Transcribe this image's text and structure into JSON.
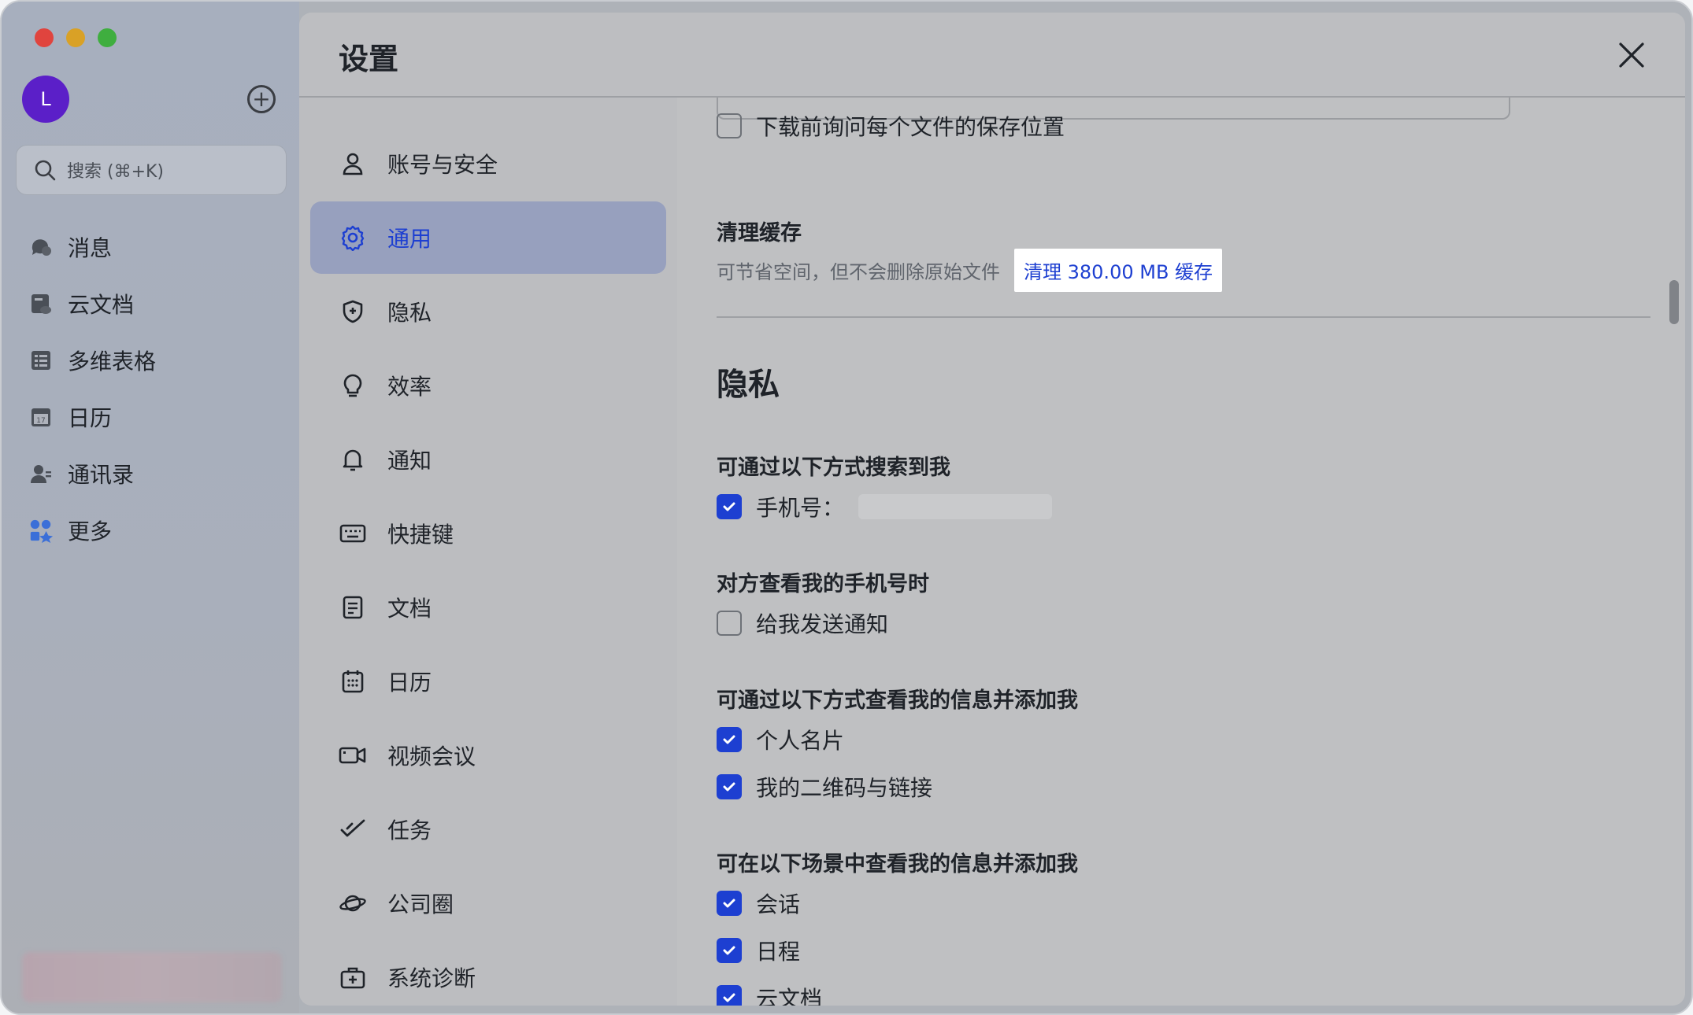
{
  "app": {
    "avatar_letter": "L",
    "search_placeholder": "搜索 (⌘+K)",
    "nav": [
      {
        "label": "消息",
        "icon": "chat-bubble-icon"
      },
      {
        "label": "云文档",
        "icon": "cloud-doc-icon"
      },
      {
        "label": "多维表格",
        "icon": "table-icon"
      },
      {
        "label": "日历",
        "icon": "calendar-icon"
      },
      {
        "label": "通讯录",
        "icon": "contacts-icon"
      },
      {
        "label": "更多",
        "icon": "more-apps-icon"
      }
    ]
  },
  "dialog": {
    "title": "设置",
    "nav": [
      {
        "label": "账号与安全",
        "icon": "user-icon"
      },
      {
        "label": "通用",
        "icon": "gear-icon"
      },
      {
        "label": "隐私",
        "icon": "shield-icon"
      },
      {
        "label": "效率",
        "icon": "lightbulb-icon"
      },
      {
        "label": "通知",
        "icon": "bell-icon"
      },
      {
        "label": "快捷键",
        "icon": "keyboard-icon"
      },
      {
        "label": "文档",
        "icon": "document-icon"
      },
      {
        "label": "日历",
        "icon": "calendar-icon"
      },
      {
        "label": "视频会议",
        "icon": "video-icon"
      },
      {
        "label": "任务",
        "icon": "task-icon"
      },
      {
        "label": "公司圈",
        "icon": "planet-icon"
      },
      {
        "label": "系统诊断",
        "icon": "toolbox-icon"
      }
    ],
    "active_nav": "通用"
  },
  "general": {
    "download_ask_location": "下载前询问每个文件的保存位置",
    "clear_cache_title": "清理缓存",
    "clear_cache_desc": "可节省空间，但不会删除原始文件",
    "clear_cache_link": "清理 380.00 MB 缓存"
  },
  "privacy": {
    "title": "隐私",
    "search_by_title": "可通过以下方式搜索到我",
    "phone_label": "手机号：",
    "view_phone_title": "对方查看我的手机号时",
    "notify_me": "给我发送通知",
    "add_by_title": "可通过以下方式查看我的信息并添加我",
    "personal_card": "个人名片",
    "qr_and_link": "我的二维码与链接",
    "scenes_title": "可在以下场景中查看我的信息并添加我",
    "scene_chat": "会话",
    "scene_schedule": "日程",
    "scene_docs": "云文档"
  },
  "colors": {
    "accent": "#1d3fd1",
    "avatar_bg": "#5b1fc8"
  }
}
